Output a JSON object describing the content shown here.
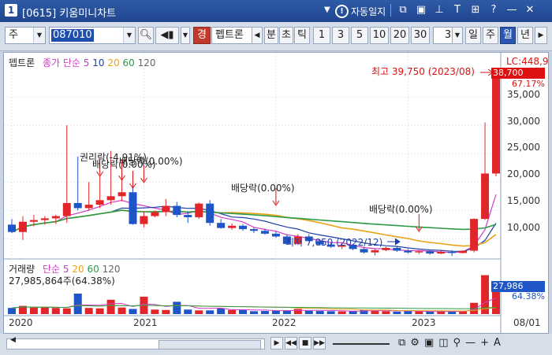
{
  "titlebar": {
    "window_number": "1",
    "title": "[0615] 키움미니차트",
    "auto_label": "자동일지",
    "icons": [
      "restore-icon",
      "window-icon",
      "pin-icon",
      "text-icon",
      "grid-icon",
      "help-icon",
      "minimize-icon",
      "close-icon"
    ]
  },
  "toolbar": {
    "market_select": "주",
    "code_value": "087010",
    "stock_badge": "경",
    "stock_name": "펩트론",
    "period_tabs": [
      "분",
      "초",
      "틱"
    ],
    "numbers": [
      "1",
      "3",
      "5",
      "10",
      "20",
      "30"
    ],
    "count_select": "3",
    "range_tabs": [
      "일",
      "주",
      "월",
      "년"
    ],
    "active_range": "월"
  },
  "chart": {
    "legend_name": "펩트론",
    "legend_ma": "종가 단순",
    "ma_periods": [
      "5",
      "10",
      "20",
      "60",
      "120"
    ],
    "max_label": "최고 39,750 (2023/08)",
    "min_label": "최저 7,050 (2022/12)",
    "dividend_labels": [
      "권리락(-4.91%)",
      "배당락(0.00%)",
      "배당락(0.00%)",
      "배당락(0.00%)",
      "배당락(0.00%)"
    ],
    "price_axis": [
      "35,000",
      "30,000",
      "25,000",
      "20,000",
      "15,000",
      "10,000"
    ],
    "lc_label": "LC:448,9",
    "current_price": "38,700",
    "current_pct": "67.17%",
    "vol_legend_name": "거래량",
    "vol_legend_ma": "단순",
    "vol_ma_periods": [
      "5",
      "20",
      "60",
      "120"
    ],
    "vol_info": "27,985,864주(64.38%)",
    "vol_badge": "27,986",
    "vol_pct": "64.38%",
    "x_labels": [
      "2020",
      "2021",
      "2022",
      "2023",
      "08/01"
    ],
    "colors": {
      "up": "#e0262a",
      "down": "#1f56c7",
      "ma5": "#d23bc8",
      "ma10": "#1f3fa8",
      "ma20": "#e8a317",
      "ma60": "#2e9a47",
      "ma120": "#666666"
    }
  },
  "chart_data": {
    "type": "candlestick",
    "title": "펩트론",
    "period": "monthly",
    "series": [
      {
        "name": "price",
        "ohlc": [
          [
            12500,
            13500,
            11000,
            11200
          ],
          [
            11200,
            14000,
            9800,
            13000
          ],
          [
            13000,
            14200,
            12200,
            13300
          ],
          [
            13300,
            14000,
            12500,
            13600
          ],
          [
            13600,
            14200,
            12600,
            14000
          ],
          [
            14000,
            30000,
            12800,
            16300
          ],
          [
            16300,
            24500,
            15000,
            15400
          ],
          [
            15400,
            20000,
            15000,
            16000
          ],
          [
            16000,
            21000,
            15400,
            16800
          ],
          [
            16800,
            25500,
            16000,
            17500
          ],
          [
            17500,
            24000,
            16600,
            18200
          ],
          [
            18200,
            19200,
            12500,
            12600
          ],
          [
            12600,
            14800,
            12000,
            14000
          ],
          [
            14000,
            15000,
            13800,
            14700
          ],
          [
            14700,
            17000,
            14000,
            15800
          ],
          [
            15800,
            16500,
            13800,
            14200
          ],
          [
            14200,
            14800,
            12800,
            13800
          ],
          [
            13800,
            16400,
            13500,
            16200
          ],
          [
            16200,
            16800,
            12300,
            12800
          ],
          [
            12800,
            13500,
            11800,
            11900
          ],
          [
            11900,
            12700,
            11600,
            12300
          ],
          [
            12300,
            12600,
            11400,
            11700
          ],
          [
            11700,
            12000,
            11000,
            11400
          ],
          [
            11400,
            11800,
            10700,
            10900
          ],
          [
            10900,
            11300,
            10200,
            10400
          ],
          [
            10400,
            10800,
            9000,
            9100
          ],
          [
            9100,
            10800,
            8900,
            10400
          ],
          [
            10400,
            10800,
            9500,
            9600
          ],
          [
            9600,
            9900,
            8800,
            9000
          ],
          [
            9000,
            9400,
            8400,
            8600
          ],
          [
            8600,
            9300,
            8200,
            8900
          ],
          [
            8900,
            9100,
            8000,
            8200
          ],
          [
            8200,
            8500,
            7400,
            7600
          ],
          [
            7600,
            8200,
            7050,
            8000
          ],
          [
            8000,
            8600,
            7800,
            8400
          ],
          [
            8400,
            8700,
            7700,
            7900
          ],
          [
            7900,
            8200,
            7400,
            7600
          ],
          [
            7600,
            8000,
            7300,
            7800
          ],
          [
            7800,
            8100,
            7200,
            7400
          ],
          [
            7400,
            7900,
            7300,
            7700
          ],
          [
            7700,
            8000,
            7000,
            7500
          ],
          [
            7500,
            8000,
            7400,
            7900
          ],
          [
            7900,
            13600,
            7600,
            13500
          ],
          [
            13500,
            30500,
            13300,
            21500
          ],
          [
            21500,
            39750,
            21000,
            38700
          ]
        ]
      },
      {
        "name": "volume",
        "values": [
          30,
          40,
          32,
          33,
          30,
          28,
          100,
          30,
          28,
          70,
          32,
          25,
          85,
          22,
          20,
          60,
          22,
          18,
          18,
          28,
          20,
          22,
          14,
          15,
          16,
          18,
          25,
          16,
          15,
          14,
          13,
          15,
          20,
          18,
          14,
          12,
          14,
          13,
          12,
          14,
          13,
          14,
          55,
          190,
          120
        ]
      }
    ],
    "ylim": [
      7000,
      40000
    ],
    "x_ticks": [
      "2020",
      "2021",
      "2022",
      "2023"
    ]
  }
}
